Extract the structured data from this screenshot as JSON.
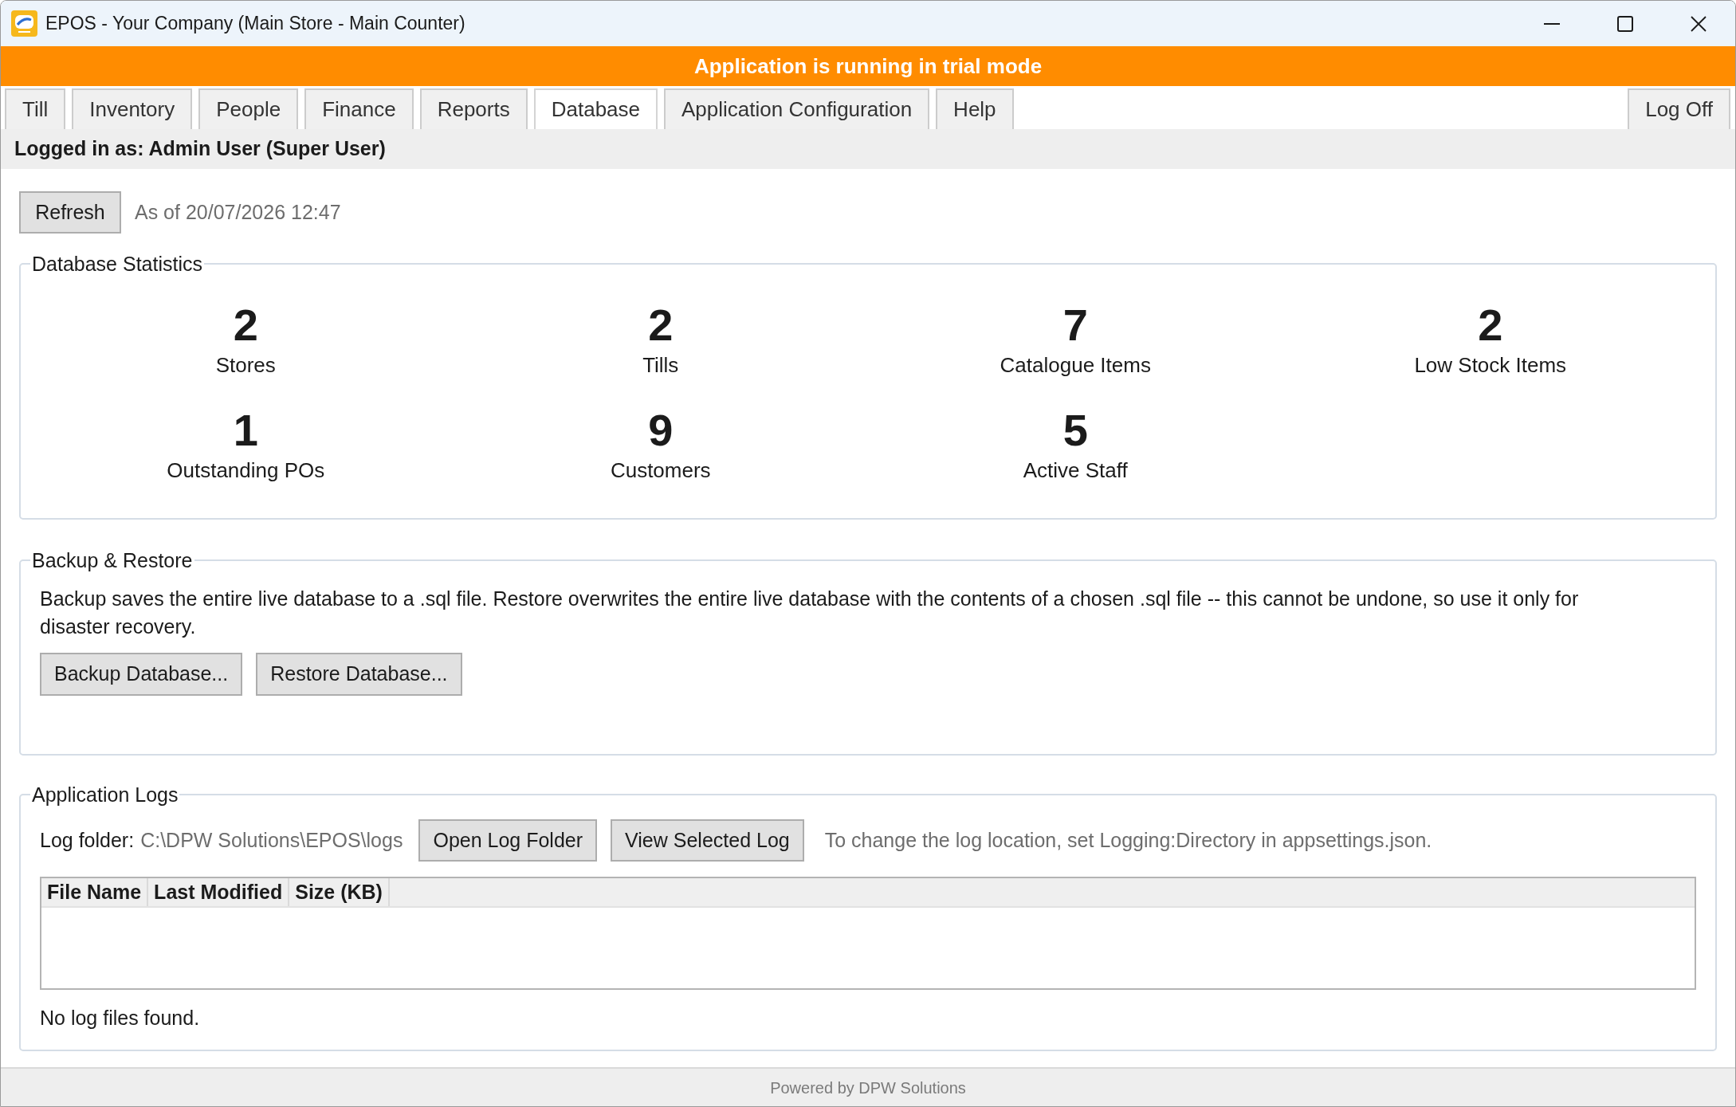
{
  "window": {
    "title": "EPOS - Your Company (Main Store - Main Counter)"
  },
  "banner": {
    "text": "Application is running in trial mode"
  },
  "tabs": [
    {
      "label": "Till",
      "selected": false
    },
    {
      "label": "Inventory",
      "selected": false
    },
    {
      "label": "People",
      "selected": false
    },
    {
      "label": "Finance",
      "selected": false
    },
    {
      "label": "Reports",
      "selected": false
    },
    {
      "label": "Database",
      "selected": true
    },
    {
      "label": "Application Configuration",
      "selected": false
    },
    {
      "label": "Help",
      "selected": false
    }
  ],
  "log_off": {
    "label": "Log Off"
  },
  "user_bar": {
    "text": "Logged in as: Admin User (Super User)"
  },
  "toolbar": {
    "refresh": "Refresh",
    "timestamp": "As of 20/07/2026 12:47"
  },
  "statistics": {
    "title": "Database Statistics",
    "items": [
      {
        "value": "2",
        "label": "Stores"
      },
      {
        "value": "2",
        "label": "Tills"
      },
      {
        "value": "7",
        "label": "Catalogue Items"
      },
      {
        "value": "2",
        "label": "Low Stock Items"
      },
      {
        "value": "1",
        "label": "Outstanding POs"
      },
      {
        "value": "9",
        "label": "Customers"
      },
      {
        "value": "5",
        "label": "Active Staff"
      }
    ]
  },
  "backup_restore": {
    "title": "Backup & Restore",
    "description": "Backup saves the entire live database to a .sql file. Restore overwrites the entire live database with the contents of a chosen .sql file -- this cannot be undone, so use it only for disaster recovery.",
    "buttons": [
      "Backup Database...",
      "Restore Database..."
    ]
  },
  "logs": {
    "title": "Application Logs",
    "folder_label": "Log folder:",
    "folder_path": "C:\\DPW Solutions\\EPOS\\logs",
    "buttons": [
      "Open Log Folder",
      "View Selected Log"
    ],
    "hint": "To change the log location, set Logging:Directory in appsettings.json.",
    "table": {
      "columns": [
        "File Name",
        "Last Modified",
        "Size (KB)"
      ]
    },
    "empty_message": "No log files found."
  },
  "status_bar": {
    "text": "Powered by DPW Solutions"
  }
}
